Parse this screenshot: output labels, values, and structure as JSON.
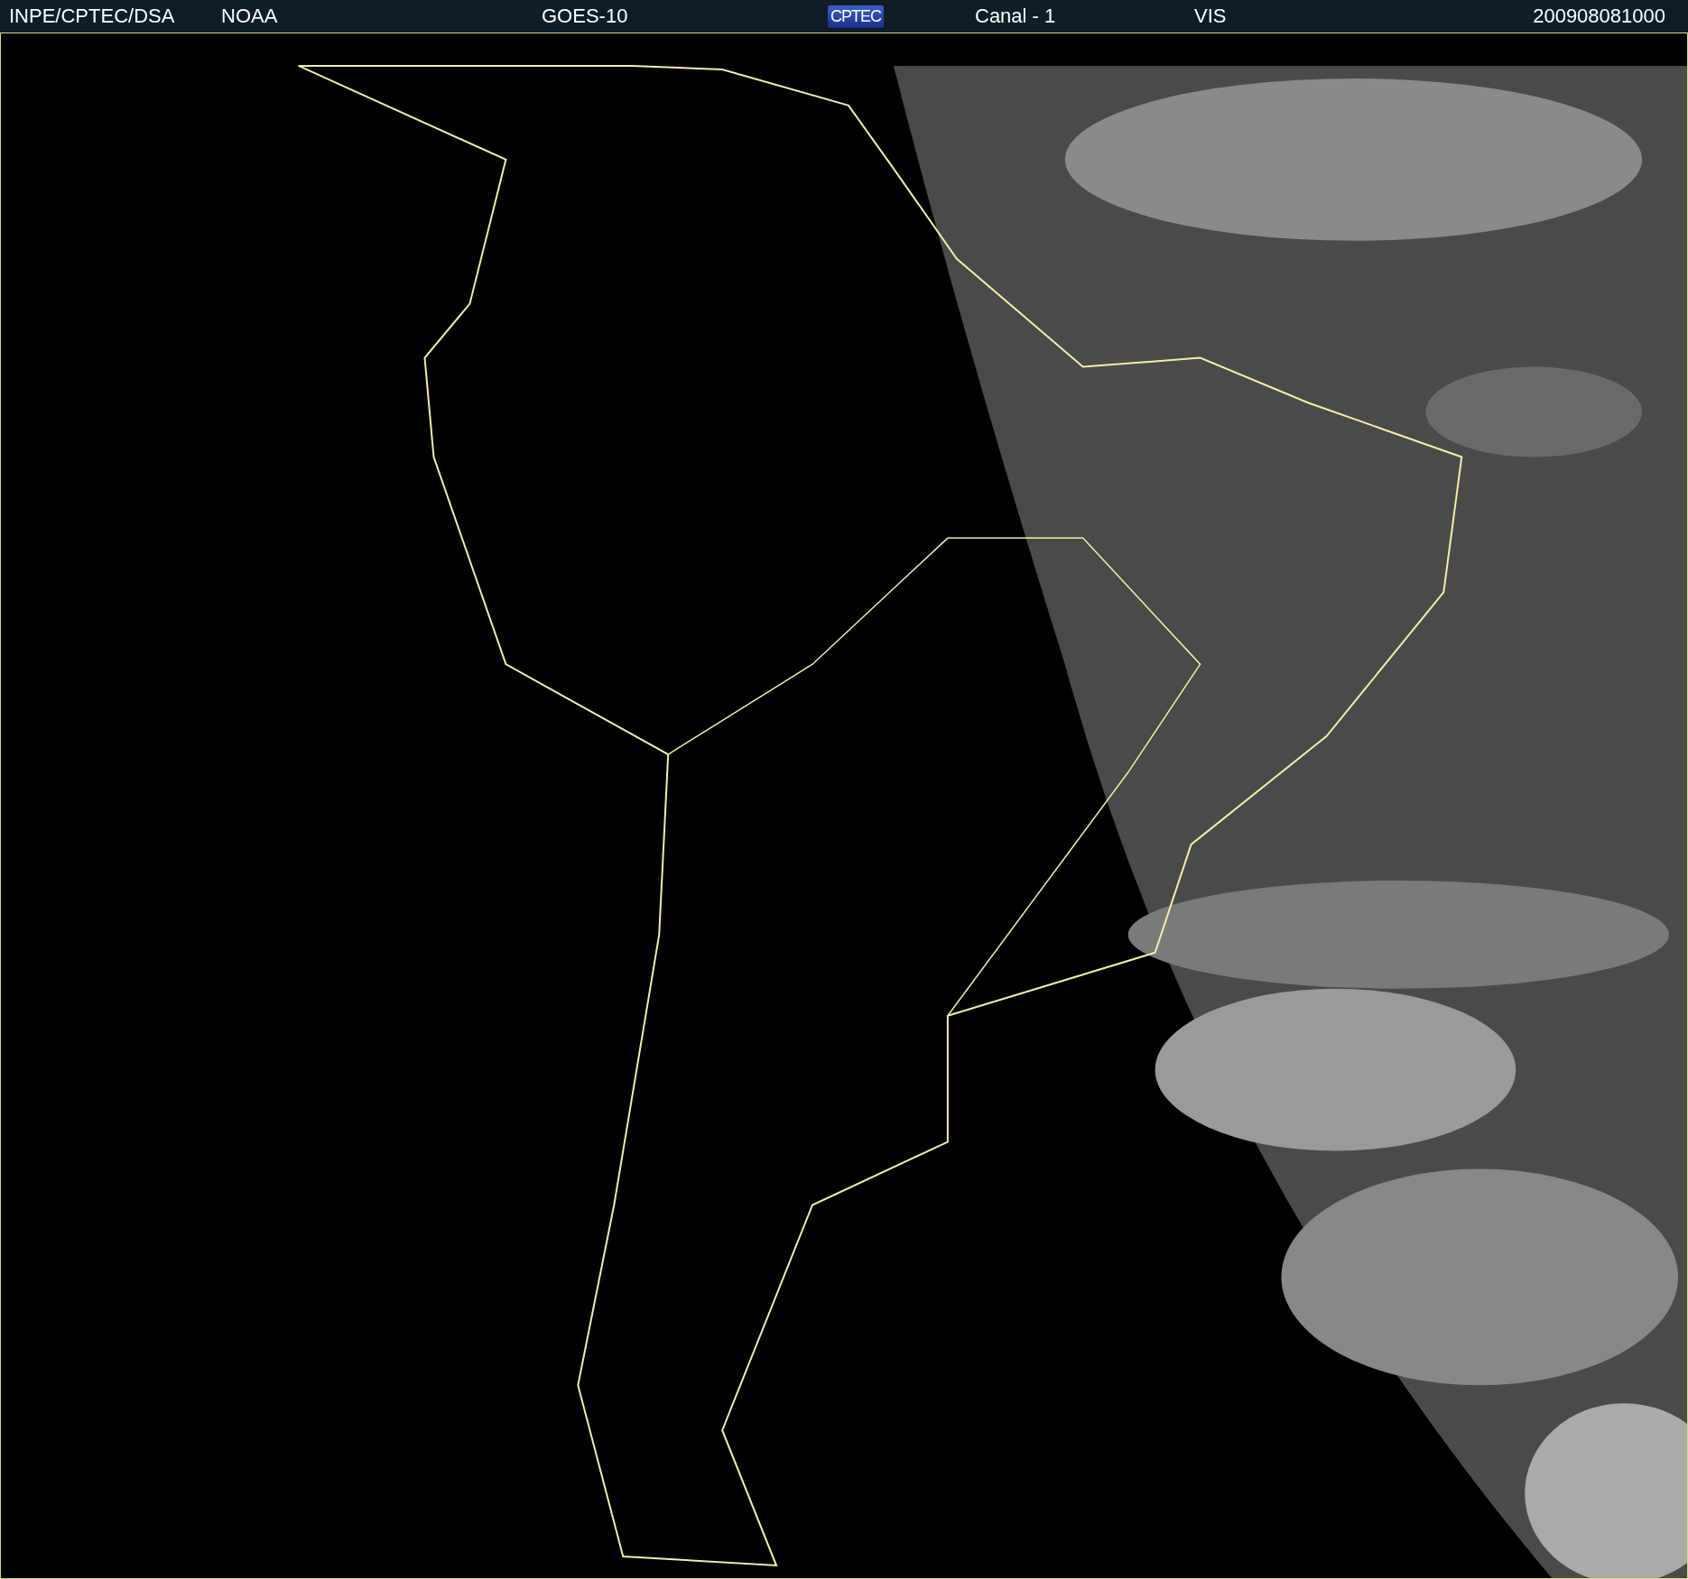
{
  "header": {
    "items": [
      {
        "kind": "text",
        "text": "INPE/CPTEC/DSA"
      },
      {
        "kind": "text",
        "text": "NOAA"
      },
      {
        "kind": "text",
        "text": "GOES-10"
      },
      {
        "kind": "logo",
        "text": "CPTEC"
      },
      {
        "kind": "text",
        "text": "Canal - 1"
      },
      {
        "kind": "text",
        "text": "VIS"
      },
      {
        "kind": "text",
        "text": "200908081000"
      }
    ]
  }
}
